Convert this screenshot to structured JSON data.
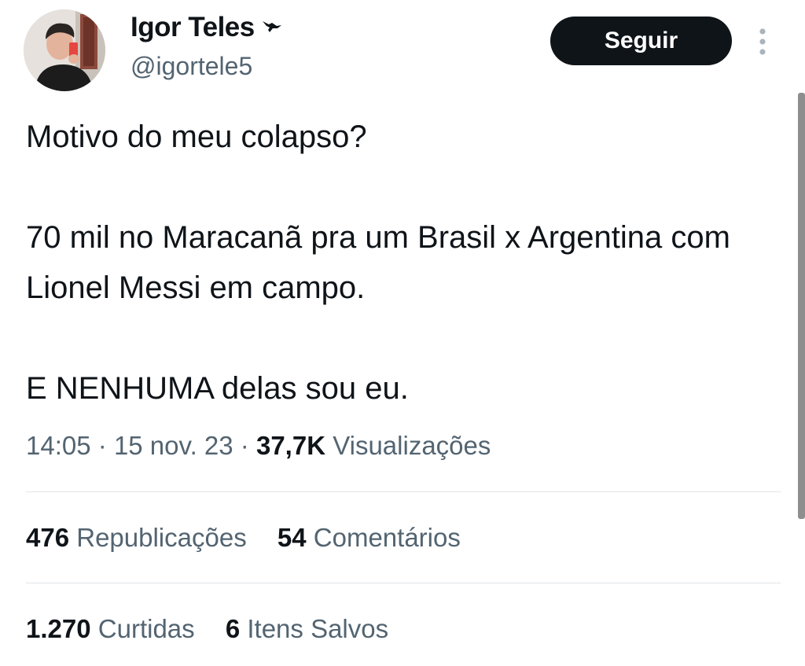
{
  "author": {
    "name": "Igor Teles",
    "handle": "@igortele5",
    "badge_icon": "hummingbird-icon"
  },
  "follow_button": {
    "label": "Seguir"
  },
  "more_icon": "vertical-dots-icon",
  "tweet": {
    "paragraphs": [
      "Motivo do meu colapso?",
      "70 mil no Maracanã pra um Brasil x Argentina com Lionel Messi em campo.",
      "E NENHUMA delas sou eu."
    ]
  },
  "meta": {
    "time": "14:05",
    "separator": "·",
    "date": "15 nov. 23",
    "views_count": "37,7K",
    "views_label": "Visualizações"
  },
  "stats_row_1": [
    {
      "count": "476",
      "label": "Republicações"
    },
    {
      "count": "54",
      "label": "Comentários"
    }
  ],
  "stats_row_2": [
    {
      "count": "1.270",
      "label": "Curtidas"
    },
    {
      "count": "6",
      "label": "Itens Salvos"
    }
  ],
  "colors": {
    "text": "#0f1419",
    "secondary": "#536471",
    "button": "#0f1419",
    "divider": "#e1e4e6"
  }
}
